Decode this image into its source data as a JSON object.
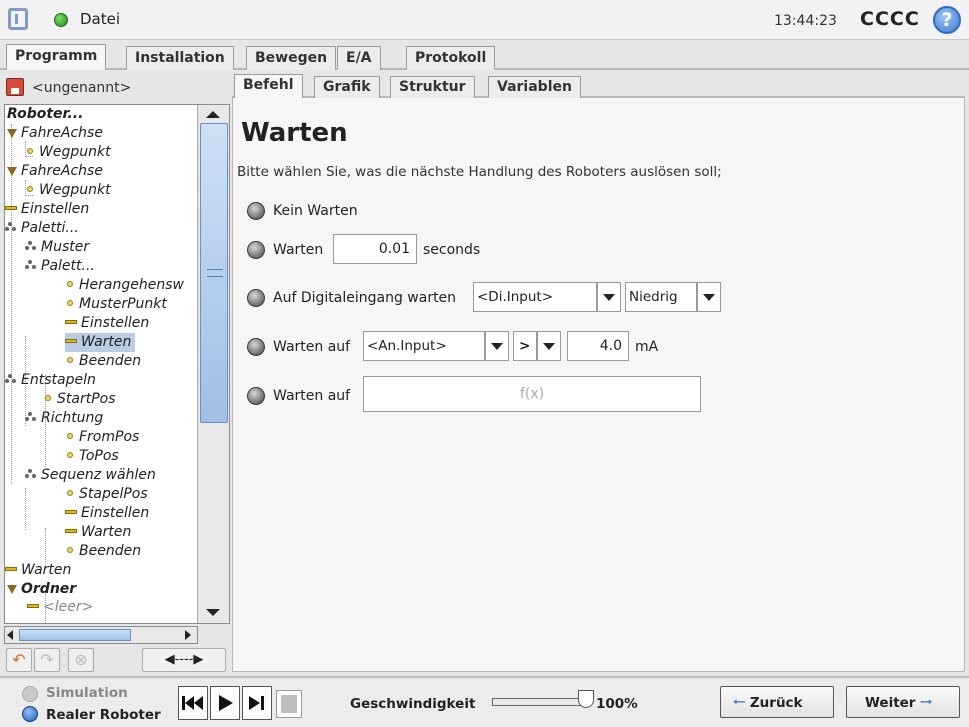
{
  "topbar": {
    "file_menu": "Datei",
    "time": "13:44:23",
    "robot_name": "CCCC",
    "help_glyph": "?"
  },
  "main_tabs": [
    {
      "label": "Programm",
      "active": true
    },
    {
      "label": "Installation"
    },
    {
      "label": "Bewegen"
    },
    {
      "label": "E/A"
    },
    {
      "label": "Protokoll"
    }
  ],
  "left": {
    "file_name": "<ungenannt>",
    "tree": [
      {
        "label": "Roboter...",
        "bold": true
      },
      {
        "label": "FahreAchse"
      },
      {
        "label": "Wegpunkt"
      },
      {
        "label": "FahreAchse"
      },
      {
        "label": "Wegpunkt"
      },
      {
        "label": "Einstellen"
      },
      {
        "label": "Paletti..."
      },
      {
        "label": "Muster"
      },
      {
        "label": "Palett..."
      },
      {
        "label": "Herangehensw"
      },
      {
        "label": "MusterPunkt"
      },
      {
        "label": "Einstellen"
      },
      {
        "label": "Warten",
        "selected": true
      },
      {
        "label": "Beenden"
      },
      {
        "label": "Entstapeln"
      },
      {
        "label": "StartPos"
      },
      {
        "label": "Richtung"
      },
      {
        "label": "FromPos"
      },
      {
        "label": "ToPos"
      },
      {
        "label": "Sequenz wählen"
      },
      {
        "label": "StapelPos"
      },
      {
        "label": "Einstellen"
      },
      {
        "label": "Warten"
      },
      {
        "label": "Beenden"
      },
      {
        "label": "Warten"
      },
      {
        "label": "Ordner",
        "bold": true
      },
      {
        "label": "<leer>"
      }
    ]
  },
  "sub_tabs": [
    {
      "label": "Befehl",
      "active": true
    },
    {
      "label": "Grafik"
    },
    {
      "label": "Struktur"
    },
    {
      "label": "Variablen"
    }
  ],
  "panel": {
    "title": "Warten",
    "description": "Bitte wählen Sie, was die nächste Handlung des Roboters auslösen soll;",
    "opt_no_wait": "Kein Warten",
    "opt_wait": "Warten",
    "wait_value": "0.01",
    "wait_unit": "seconds",
    "opt_digital": "Auf Digitaleingang warten",
    "digital_input": "<Di.Input>",
    "digital_level": "Niedrig",
    "opt_analog": "Warten auf",
    "analog_input": "<An.Input>",
    "analog_operator": ">",
    "analog_value": "4.0",
    "analog_unit": "mA",
    "opt_expression": "Warten auf",
    "expression_placeholder": "f(x)"
  },
  "bottom": {
    "simulation": "Simulation",
    "real_robot": "Realer Roboter",
    "speed_label": "Geschwindigkeit",
    "speed_percent": "100%",
    "speed_fraction": 1.0,
    "back": "Zurück",
    "next": "Weiter"
  },
  "colors": {
    "accent_blue": "#3f7fd4",
    "selection": "#b9cde6",
    "status_green": "#1f8a1a"
  }
}
